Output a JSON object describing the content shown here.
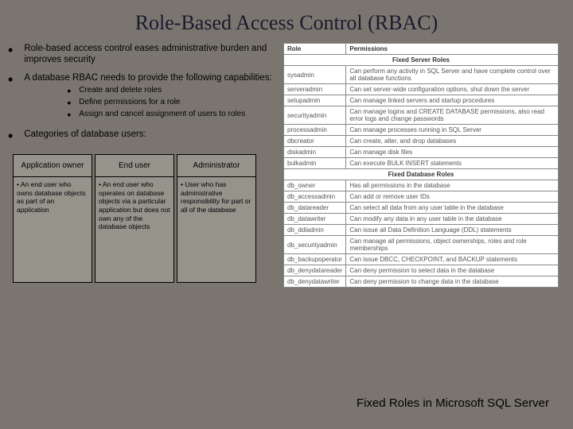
{
  "title": "Role-Based Access Control (RBAC)",
  "bullets": {
    "b1": "Role-based access control eases administrative burden and improves security",
    "b2": "A database RBAC needs to provide the following capabilities:",
    "b3": "Categories of database users:"
  },
  "subs": {
    "s1": "Create and delete roles",
    "s2": "Define permissions for a role",
    "s3": "Assign and cancel assignment of users to roles"
  },
  "users": {
    "c1": {
      "head": "Application owner",
      "body": "• An end user who owns database objects as part of an application"
    },
    "c2": {
      "head": "End user",
      "body": "• An end user who operates on database objects via a particular application but does not own any of the database objects"
    },
    "c3": {
      "head": "Administrator",
      "body": "• User who has administrative responsibility for part or all of the database"
    }
  },
  "caption": "Fixed Roles in Microsoft SQL Server",
  "roles": {
    "hdr_role": "Role",
    "hdr_perm": "Permissions",
    "sec1": "Fixed Server Roles",
    "sec2": "Fixed Database Roles",
    "r": [
      {
        "n": "sysadmin",
        "p": "Can perform any activity in SQL Server and have complete control over all database functions"
      },
      {
        "n": "serveradmin",
        "p": "Can set server-wide configuration options, shut down the server"
      },
      {
        "n": "setupadmin",
        "p": "Can manage linked servers and startup procedures"
      },
      {
        "n": "securityadmin",
        "p": "Can manage logins and CREATE DATABASE permissions, also read error logs and change passwords"
      },
      {
        "n": "processadmin",
        "p": "Can manage processes running in SQL Server"
      },
      {
        "n": "dbcreator",
        "p": "Can create, alter, and drop databases"
      },
      {
        "n": "diskadmin",
        "p": "Can manage disk files"
      },
      {
        "n": "bulkadmin",
        "p": "Can execute BULK INSERT statements"
      },
      {
        "n": "db_owner",
        "p": "Has all permissions in the database"
      },
      {
        "n": "db_accessadmin",
        "p": "Can add or remove user IDs"
      },
      {
        "n": "db_datareader",
        "p": "Can select all data from any user table in the database"
      },
      {
        "n": "db_datawriter",
        "p": "Can modify any data in any user table in the database"
      },
      {
        "n": "db_ddladmin",
        "p": "Can issue all Data Definition Language (DDL) statements"
      },
      {
        "n": "db_securityadmin",
        "p": "Can manage all permissions, object ownerships, roles and role memberships"
      },
      {
        "n": "db_backupoperator",
        "p": "Can issue DBCC, CHECKPOINT, and BACKUP statements"
      },
      {
        "n": "db_denydatareader",
        "p": "Can deny permission to select data in the database"
      },
      {
        "n": "db_denydatawriter",
        "p": "Can deny permission to change data in the database"
      }
    ]
  }
}
